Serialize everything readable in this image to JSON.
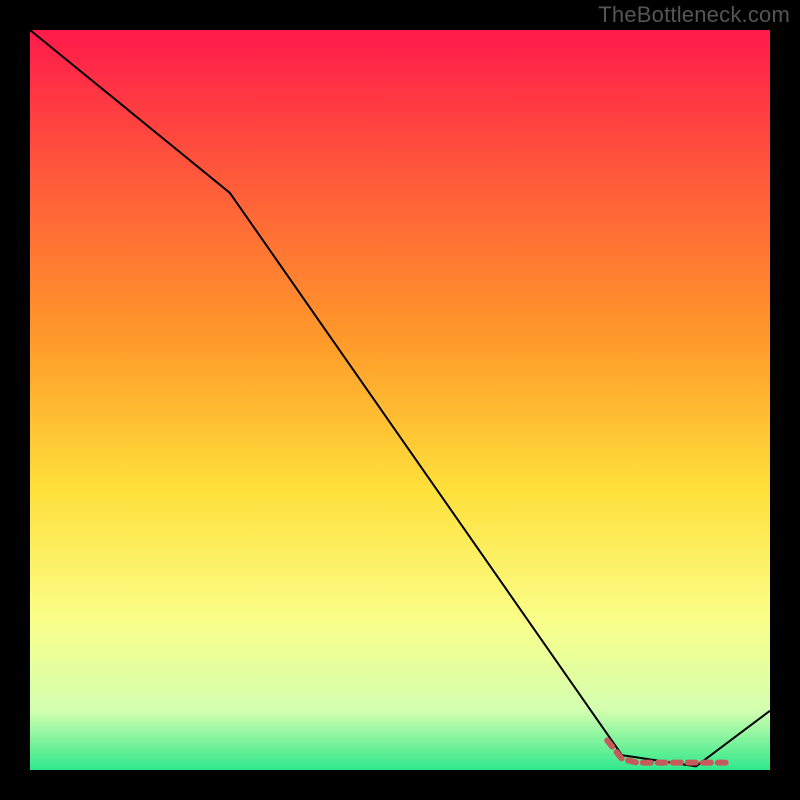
{
  "header": {
    "watermark": "TheBottleneck.com"
  },
  "colors": {
    "background": "#000000",
    "line": "#000000",
    "dashed": "#c75a5a",
    "gradient_top": "#ff1a4b",
    "gradient_upper_mid": "#ff9a2a",
    "gradient_mid": "#ffe03a",
    "gradient_lower_mid": "#faff8a",
    "gradient_near_bottom": "#d2ffb0",
    "gradient_bottom": "#2fe88a"
  },
  "chart_data": {
    "type": "line",
    "title": "",
    "xlabel": "",
    "ylabel": "",
    "xlim": [
      0,
      100
    ],
    "ylim": [
      0,
      100
    ],
    "grid": false,
    "legend": false,
    "series": [
      {
        "name": "bottleneck-curve",
        "style": "solid",
        "x": [
          0,
          27,
          80,
          90,
          100
        ],
        "values": [
          100,
          78,
          2,
          0.5,
          8
        ]
      },
      {
        "name": "optimal-zone",
        "style": "dashed",
        "x": [
          78,
          80,
          82,
          94
        ],
        "values": [
          4,
          1.5,
          1,
          1
        ]
      }
    ],
    "annotations": []
  }
}
